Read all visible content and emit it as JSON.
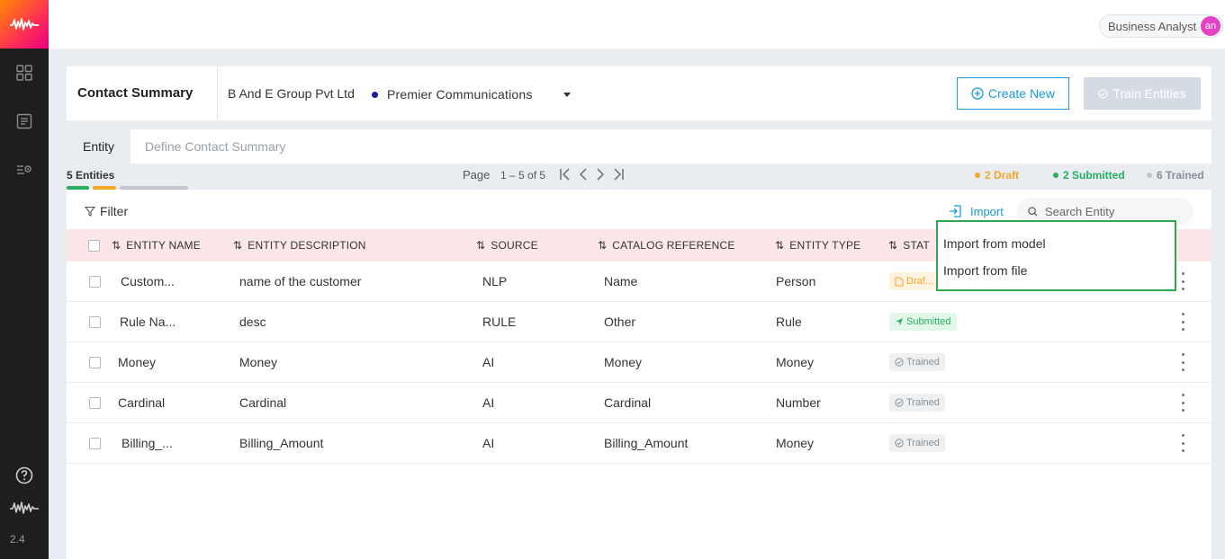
{
  "app": {
    "version": "2.4"
  },
  "rail": {
    "icons": [
      "dashboard-icon",
      "document-icon",
      "settings-list-icon",
      "help-icon",
      "brand-wave-icon"
    ]
  },
  "user": {
    "role": "Business Analyst",
    "initials": "an",
    "avatar_color": "#e541c4"
  },
  "header": {
    "title": "Contact Summary",
    "org": "B And E Group Pvt Ltd",
    "project": "Premier Communications",
    "create_label": "Create New",
    "train_label": "Train Entities"
  },
  "tabs": [
    {
      "label": "Entity",
      "active": true
    },
    {
      "label": "Define Contact Summary",
      "active": false
    }
  ],
  "summary": {
    "entities_count": "5 Entities",
    "page_label": "Page",
    "page_range": "1 – 5 of 5",
    "draft": "2 Draft",
    "submitted": "2 Submitted",
    "trained": "6 Trained",
    "colors": {
      "draft": "#f5a623",
      "submitted": "#27ae60",
      "trained": "#c2c6cb",
      "accent": "#1a9ad6"
    }
  },
  "toolbar": {
    "filter_label": "Filter",
    "import_label": "Import",
    "search_placeholder": "Search Entity"
  },
  "import_menu": {
    "items": [
      "Import from model",
      "Import from file"
    ]
  },
  "table": {
    "columns": [
      "ENTITY NAME",
      "ENTITY DESCRIPTION",
      "SOURCE",
      "CATALOG REFERENCE",
      "ENTITY TYPE",
      "STAT"
    ],
    "rows": [
      {
        "name": "Custom...",
        "description": "name of the customer",
        "source": "NLP",
        "catalog": "Name",
        "type": "Person",
        "status": "Draf..."
      },
      {
        "name": "Rule Na...",
        "description": "desc",
        "source": "RULE",
        "catalog": "Other",
        "type": "Rule",
        "status": "Submitted"
      },
      {
        "name": "Money",
        "description": "Money",
        "source": "AI",
        "catalog": "Money",
        "type": "Money",
        "status": "Trained"
      },
      {
        "name": "Cardinal",
        "description": "Cardinal",
        "source": "AI",
        "catalog": "Cardinal",
        "type": "Number",
        "status": "Trained"
      },
      {
        "name": "Billing_...",
        "description": "Billing_Amount",
        "source": "AI",
        "catalog": "Billing_Amount",
        "type": "Money",
        "status": "Trained"
      }
    ]
  }
}
